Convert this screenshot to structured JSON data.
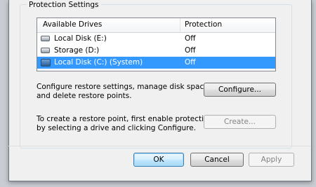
{
  "group": {
    "title": "Protection Settings"
  },
  "drives": {
    "headers": {
      "drive": "Available Drives",
      "protection": "Protection"
    },
    "rows": [
      {
        "name": "Local Disk (E:)",
        "protection": "Off",
        "icon": "drive-icon"
      },
      {
        "name": "Storage (D:)",
        "protection": "Off",
        "icon": "drive-icon"
      },
      {
        "name": "Local Disk (C:) (System)",
        "protection": "Off",
        "icon": "system-drive-icon",
        "selected": true
      }
    ]
  },
  "configure": {
    "description": "Configure restore settings, manage disk space, and delete restore points.",
    "line1": "Configure restore settings, manage disk space,",
    "line2": "and delete restore points.",
    "button": "Configure..."
  },
  "create": {
    "line1": "To create a restore point, first enable protection",
    "line2": "by selecting a drive and clicking Configure.",
    "button": "Create..."
  },
  "footer": {
    "ok": "OK",
    "cancel": "Cancel",
    "apply": "Apply"
  },
  "colors": {
    "selection": "#3399ff",
    "focus_border": "#3c7fb1"
  }
}
